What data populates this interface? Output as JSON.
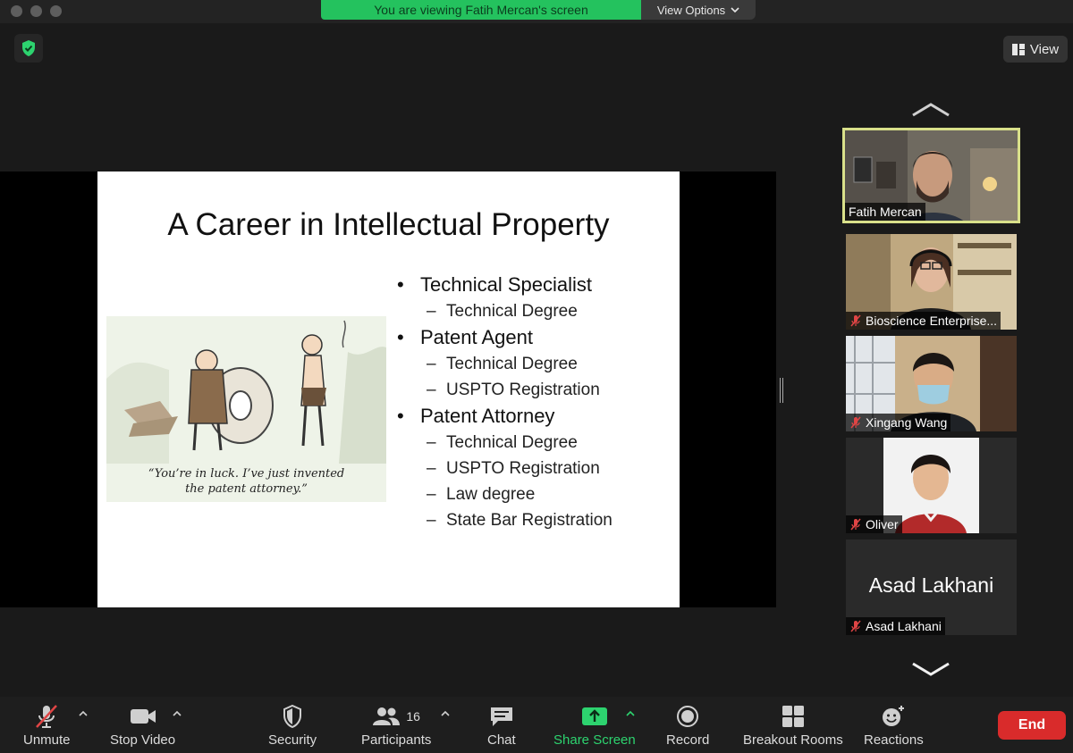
{
  "window": {
    "share_banner": "You are viewing Fatih Mercan's screen",
    "view_options_label": "View Options"
  },
  "top": {
    "view_label": "View"
  },
  "slide": {
    "title": "A Career in Intellectual Property",
    "items": [
      {
        "label": "Technical Specialist",
        "subs": [
          "Technical Degree"
        ]
      },
      {
        "label": "Patent Agent",
        "subs": [
          "Technical Degree",
          "USPTO Registration"
        ]
      },
      {
        "label": "Patent Attorney",
        "subs": [
          "Technical Degree",
          "USPTO Registration",
          "Law degree",
          "State Bar Registration"
        ]
      }
    ],
    "caption_line1": "“You’re in luck. I’ve just invented",
    "caption_line2": "the patent attorney.”"
  },
  "participants": [
    {
      "name": "Fatih Mercan",
      "muted": false,
      "active": true,
      "video": true
    },
    {
      "name": "Bioscience Enterprise...",
      "muted": true,
      "active": false,
      "video": true
    },
    {
      "name": "Xingang Wang",
      "muted": true,
      "active": false,
      "video": true
    },
    {
      "name": "Oliver",
      "muted": true,
      "active": false,
      "video": true
    },
    {
      "name": "Asad Lakhani",
      "muted": true,
      "active": false,
      "video": false,
      "display_name": "Asad Lakhani"
    }
  ],
  "toolbar": {
    "unmute": "Unmute",
    "stop_video": "Stop Video",
    "security": "Security",
    "participants": "Participants",
    "participants_count": "16",
    "chat": "Chat",
    "share_screen": "Share Screen",
    "record": "Record",
    "breakout_rooms": "Breakout Rooms",
    "reactions": "Reactions",
    "end": "End"
  },
  "colors": {
    "share_green": "#24c25e",
    "end_red": "#d92b2b",
    "active_border": "#d9e08a",
    "mute_red": "#e04545"
  }
}
